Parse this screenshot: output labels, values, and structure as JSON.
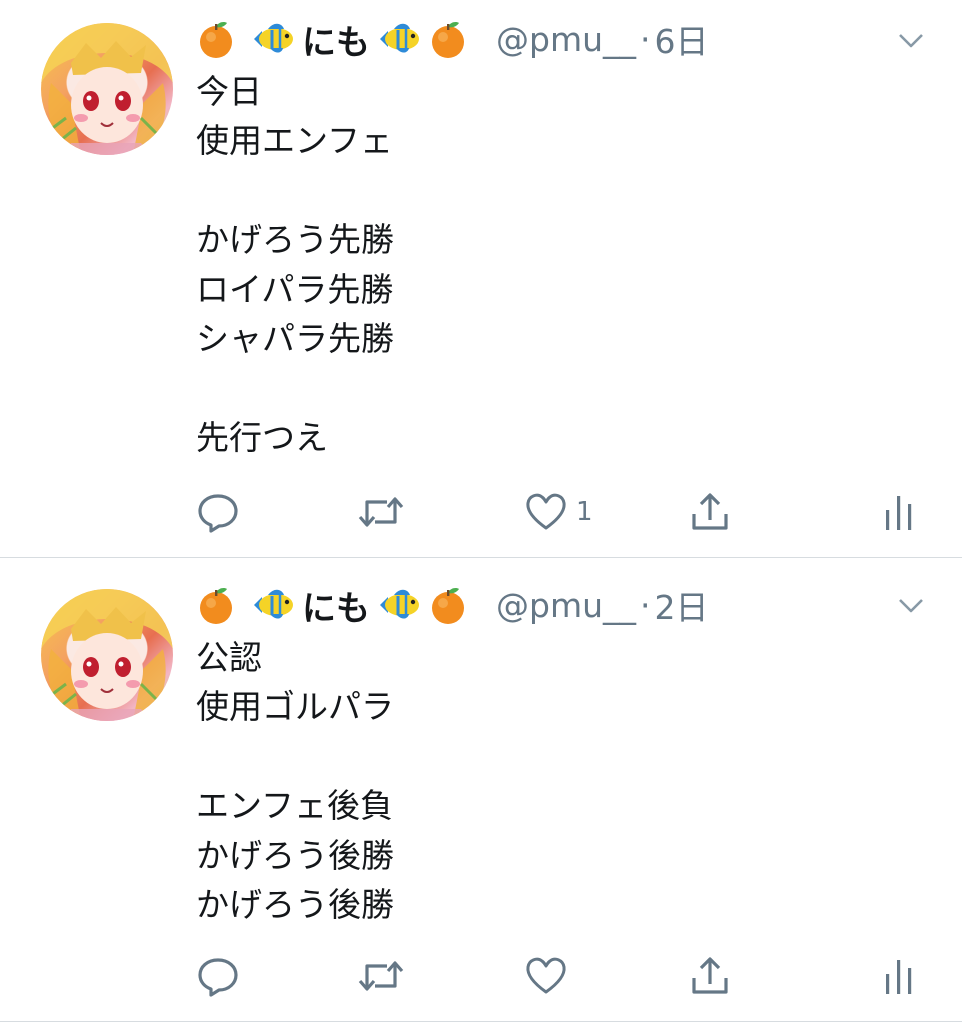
{
  "tweets": [
    {
      "display_name": "にも",
      "handle": "@pmu__",
      "separator": "·",
      "time": "6日",
      "lines": [
        "今日",
        "使用エンフェ",
        "",
        "かげろう先勝",
        "ロイパラ先勝",
        "シャパラ先勝",
        "",
        "先行つえ"
      ],
      "like_count": "1"
    },
    {
      "display_name": "にも",
      "handle": "@pmu__",
      "separator": "·",
      "time": "2日",
      "lines": [
        "公認",
        "使用ゴルパラ",
        "",
        "エンフェ後負",
        "かげろう後勝",
        "かげろう後勝"
      ],
      "like_count": ""
    }
  ],
  "icons": {
    "name_decorations": [
      "orange-emoji",
      "tropical-fish-emoji"
    ],
    "caret": "chevron-down-icon",
    "actions": [
      "reply-icon",
      "retweet-icon",
      "like-icon",
      "share-icon",
      "analytics-icon"
    ]
  },
  "colors": {
    "text": "#14171a",
    "secondary": "#657786",
    "divider": "#d7dce0",
    "background": "#ffffff"
  }
}
